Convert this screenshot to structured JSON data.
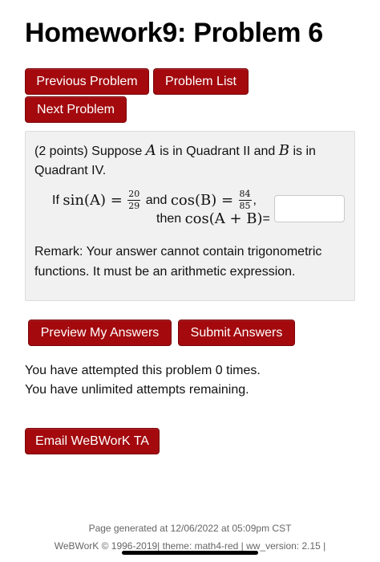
{
  "page": {
    "title": "Homework9: Problem 6"
  },
  "nav": {
    "previous_label": "Previous Problem",
    "list_label": "Problem List",
    "next_label": "Next Problem"
  },
  "problem": {
    "points": "(2 points) Suppose",
    "var_a": "A",
    "text_mid1": "is in Quadrant II and",
    "var_b": "B",
    "text_mid2": "is in Quadrant IV.",
    "if_label": "If",
    "sin_a_lhs": "sin(A) =",
    "sin_a_num": "20",
    "sin_a_den": "29",
    "and_label": "and",
    "cos_b_lhs": "cos(B) =",
    "cos_b_num": "84",
    "cos_b_den": "85",
    "comma": ",",
    "then_label": "then",
    "target": "cos(A + B)",
    "equals": "=",
    "answer_value": "",
    "remark": "Remark: Your answer cannot contain trigonometric functions. It must be an arithmetic expression."
  },
  "actions": {
    "preview_label": "Preview My Answers",
    "submit_label": "Submit Answers"
  },
  "status": {
    "attempted": "You have attempted this problem 0 times.",
    "remaining": "You have unlimited attempts remaining."
  },
  "email": {
    "label": "Email WeBWorK TA"
  },
  "footer": {
    "generated": "Page generated at 12/06/2022 at 05:09pm CST",
    "copyright": "WeBWorK © 1996-2019| theme: math4-red | ww_version: 2.15 |"
  },
  "colors": {
    "button": "#a3090d",
    "panel": "#f1f1f1"
  }
}
